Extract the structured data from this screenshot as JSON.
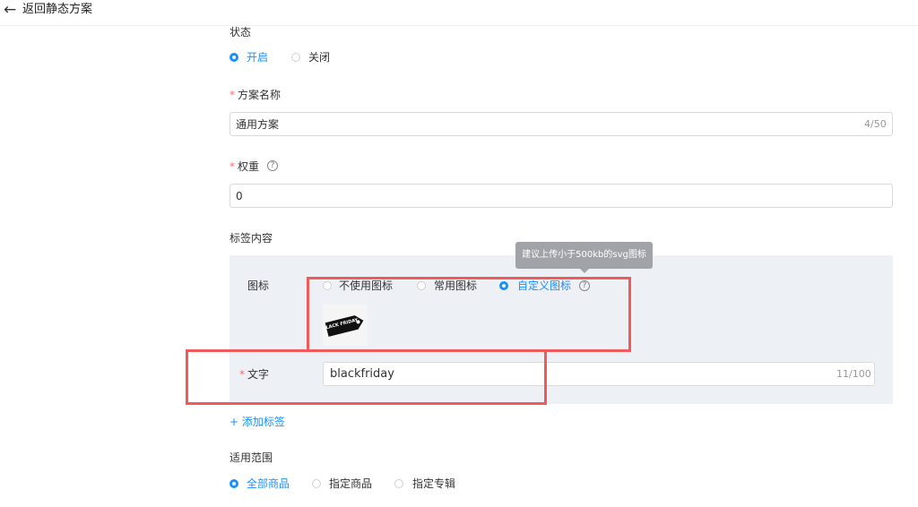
{
  "header": {
    "back_icon": "arrow-left-icon",
    "back_label": "返回静态方案"
  },
  "status": {
    "label": "状态",
    "options": [
      {
        "label": "开启",
        "selected": true
      },
      {
        "label": "关闭",
        "selected": false
      }
    ]
  },
  "plan_name": {
    "label": "方案名称",
    "required": true,
    "value": "通用方案",
    "counter": "4/50"
  },
  "weight": {
    "label": "权重",
    "required": true,
    "help_icon": "question-circle-icon",
    "value": "0"
  },
  "tag_content": {
    "label": "标签内容",
    "icon": {
      "label": "图标",
      "options": [
        {
          "label": "不使用图标",
          "selected": false
        },
        {
          "label": "常用图标",
          "selected": false
        },
        {
          "label": "自定义图标",
          "selected": true
        }
      ],
      "help_icon": "question-circle-icon",
      "tooltip": "建议上传小于500kb的svg图标",
      "preview_text": "BLACK FRIDAY"
    },
    "text": {
      "label": "文字",
      "required": true,
      "value": "blackfriday",
      "counter": "11/100"
    }
  },
  "add_tag": {
    "icon": "plus-icon",
    "label": "添加标签"
  },
  "scope": {
    "label": "适用范围",
    "options": [
      {
        "label": "全部商品",
        "selected": true
      },
      {
        "label": "指定商品",
        "selected": false
      },
      {
        "label": "指定专辑",
        "selected": false
      }
    ]
  },
  "colors": {
    "accent": "#1890ff",
    "required": "#f56c6c",
    "annotation": "#f05a5a",
    "panel": "#edf0f5"
  }
}
